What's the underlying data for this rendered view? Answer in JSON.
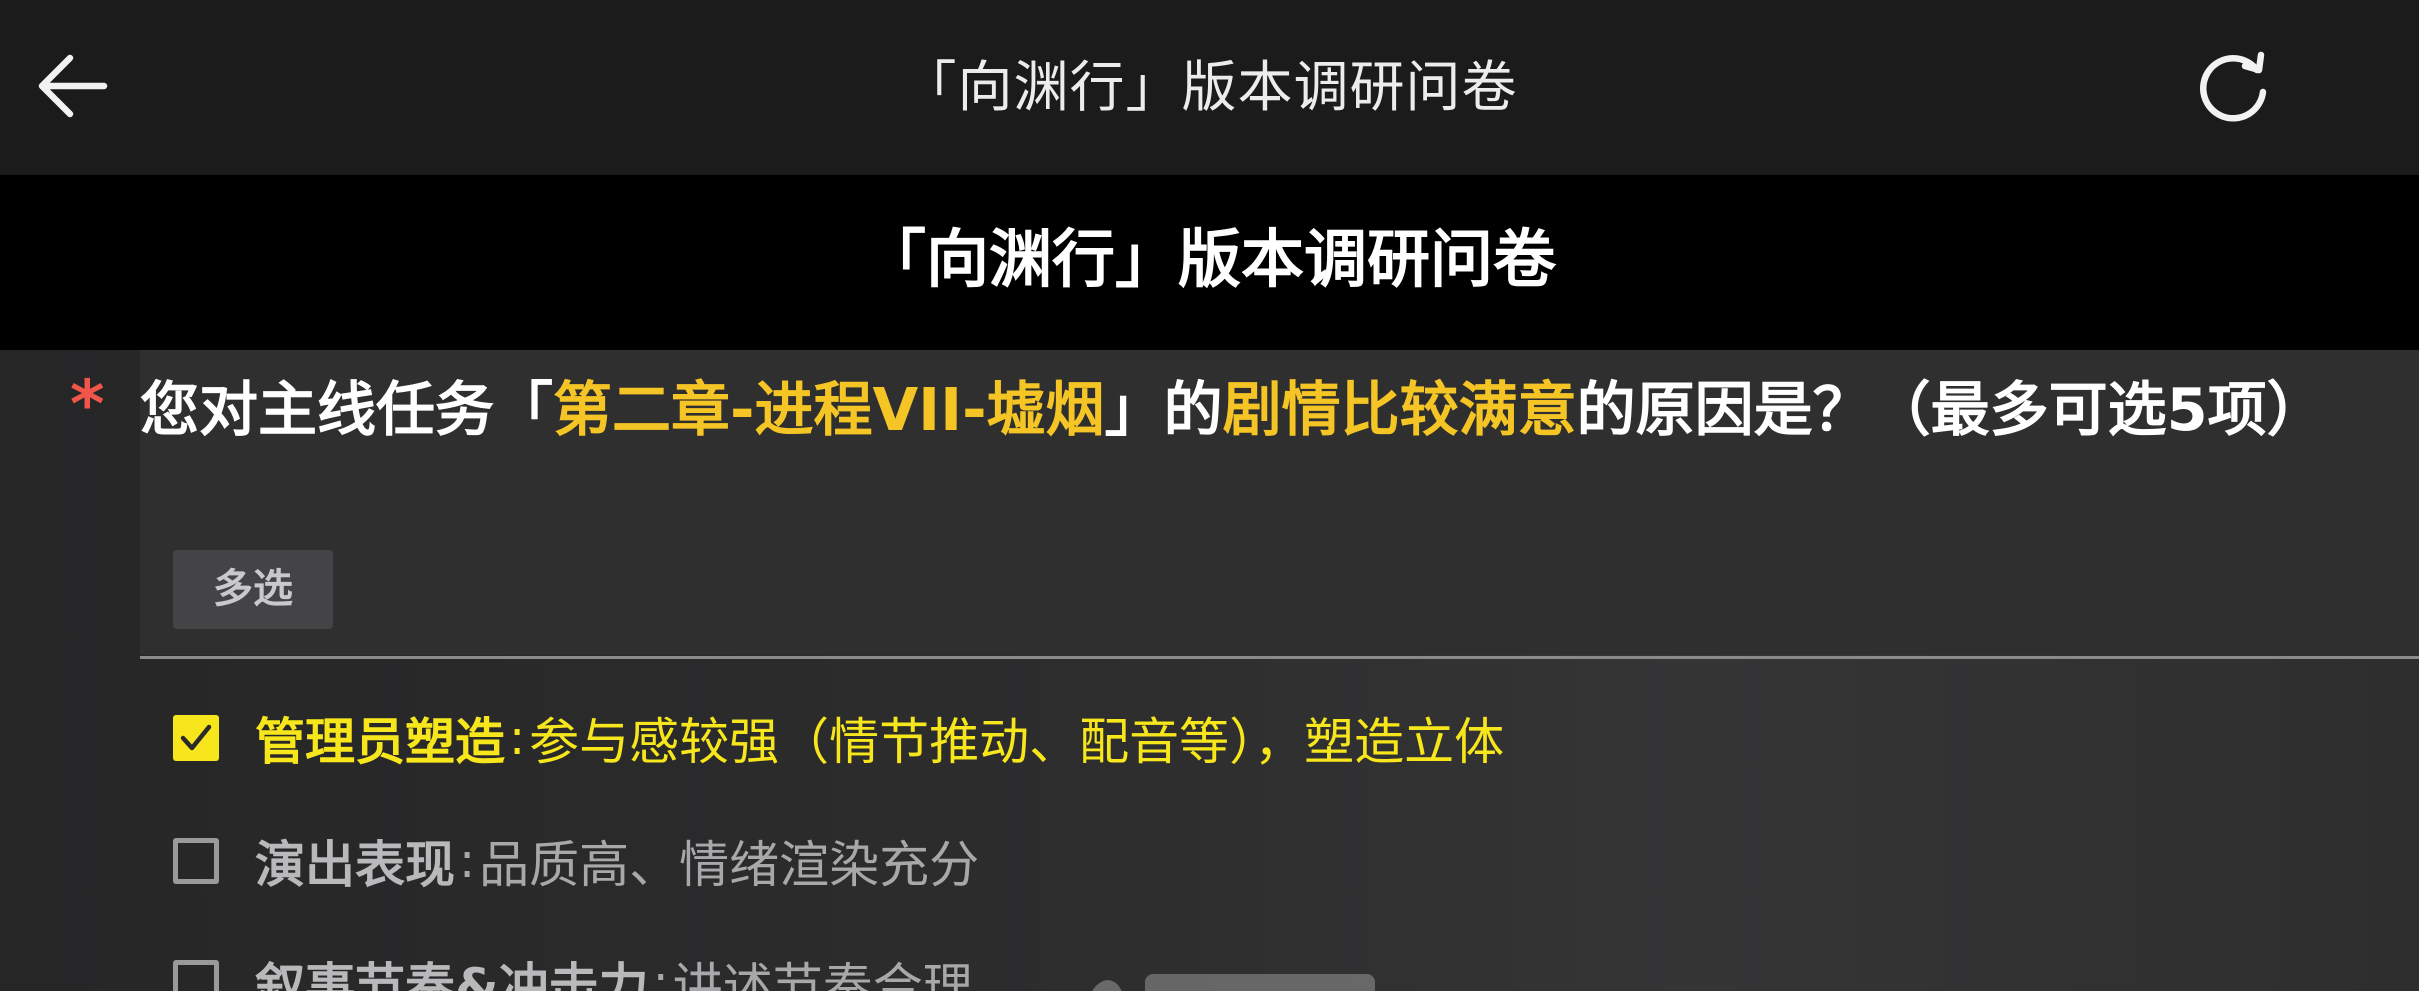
{
  "header": {
    "title": "「向渊行」版本调研问卷",
    "back_icon": "arrow-left-icon",
    "refresh_icon": "refresh-icon"
  },
  "banner": {
    "title": "「向渊行」版本调研问卷"
  },
  "question": {
    "required_mark": "*",
    "text_parts": [
      {
        "text": "您对主线任务「",
        "highlight": false
      },
      {
        "text": "第二章-进程VII-墟烟",
        "highlight": true
      },
      {
        "text": "」的",
        "highlight": false
      },
      {
        "text": "剧情比较满意",
        "highlight": true
      },
      {
        "text": "的原因是？（最多可选5项）",
        "highlight": false
      }
    ],
    "type_tag": "多选"
  },
  "options": [
    {
      "name": "管理员塑造",
      "sep": ":",
      "desc": "参与感较强（情节推动、配音等），塑造立体",
      "checked": true
    },
    {
      "name": "演出表现",
      "sep": ":",
      "desc": "品质高、情绪渲染充分",
      "checked": false
    },
    {
      "name": "叙事节奏&冲击力",
      "sep": ":",
      "desc": "讲述节奏合理",
      "checked": false
    }
  ],
  "colors": {
    "highlight": "#f4c525",
    "checked": "#f6e61b",
    "required": "#f2564b"
  }
}
